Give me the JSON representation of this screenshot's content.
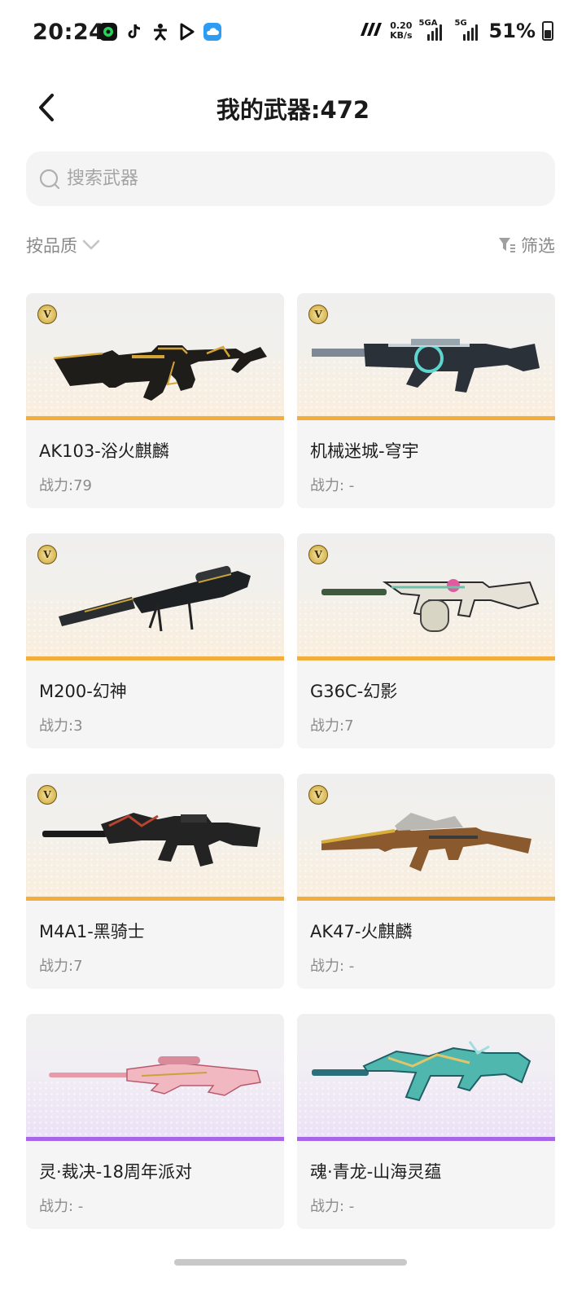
{
  "status_bar": {
    "time": "20:24",
    "app_icons": [
      "iqiyi-icon",
      "tiktok-icon",
      "figure-app-icon",
      "play-icon",
      "cloud-app-icon"
    ],
    "net_speed_value": "0.20",
    "net_speed_unit": "KB/s",
    "signal1_label": "5GA",
    "signal2_label": "5G",
    "battery_percent": "51%"
  },
  "header": {
    "title": "我的武器:472"
  },
  "search": {
    "placeholder": "搜索武器"
  },
  "toolbar": {
    "sort_label": "按品质",
    "filter_label": "筛选"
  },
  "badge_letter": "V",
  "colors": {
    "gold_accent": "#f3ad3c",
    "purple_accent": "#a566e8",
    "card_bg": "#f5f5f5"
  },
  "weapons": [
    {
      "name": "AK103-浴火麒麟",
      "power": "战力:79",
      "rarity": "gold"
    },
    {
      "name": "机械迷城-穹宇",
      "power": "战力: -",
      "rarity": "gold"
    },
    {
      "name": "M200-幻神",
      "power": "战力:3",
      "rarity": "gold"
    },
    {
      "name": "G36C-幻影",
      "power": "战力:7",
      "rarity": "gold"
    },
    {
      "name": "M4A1-黑骑士",
      "power": "战力:7",
      "rarity": "gold"
    },
    {
      "name": "AK47-火麒麟",
      "power": "战力: -",
      "rarity": "gold"
    },
    {
      "name": "灵·裁决-18周年派对",
      "power": "战力: -",
      "rarity": "purple"
    },
    {
      "name": "魂·青龙-山海灵蕴",
      "power": "战力: -",
      "rarity": "purple"
    }
  ]
}
